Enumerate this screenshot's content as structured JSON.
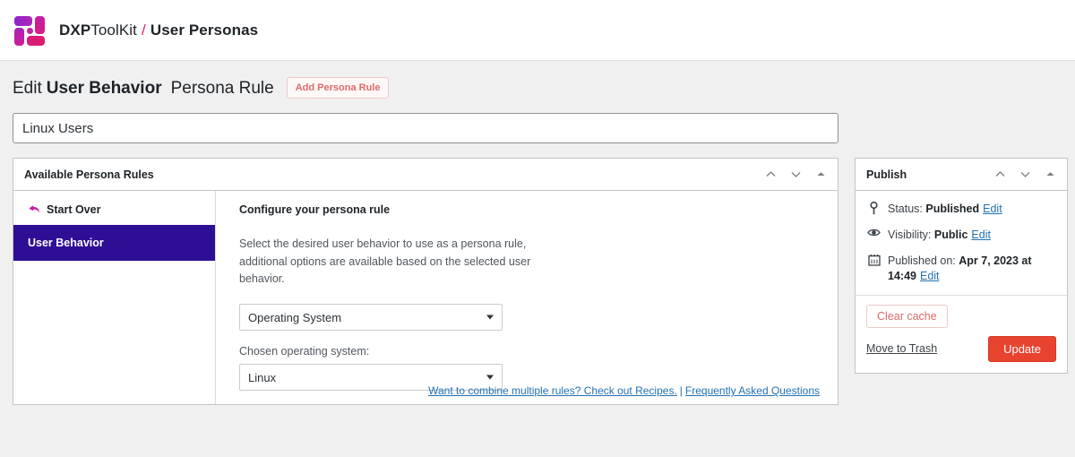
{
  "topbar": {
    "logo_icon": "dxp-logo-icon",
    "brand_strong": "DXP",
    "brand_light": "ToolKit",
    "separator": "/",
    "page_name": "User Personas"
  },
  "page": {
    "title_prefix": "Edit",
    "title_strong": "User Behavior",
    "title_suffix": "Persona Rule",
    "add_rule_label": "Add Persona Rule",
    "title_input_value": "Linux Users",
    "title_input_placeholder": "Add title"
  },
  "rules_box": {
    "heading": "Available Persona Rules",
    "tool_up_icon": "chevron-up-icon",
    "tool_down_icon": "chevron-down-icon",
    "tool_toggle_icon": "caret-up-toggle-icon",
    "nav": {
      "start_over_label": "Start Over",
      "start_over_icon": "back-arrow-icon",
      "items": [
        {
          "label": "User Behavior",
          "selected": true
        }
      ]
    },
    "content": {
      "config_title": "Configure your persona rule",
      "config_desc": "Select the desired user behavior to use as a persona rule, additional options are available based on the selected user behavior.",
      "behavior_select_value": "Operating System",
      "os_field_label": "Chosen operating system:",
      "os_select_value": "Linux",
      "recipes_link": "Want to combine multiple rules? Check out Recipes.",
      "link_separator": "|",
      "faq_link": "Frequently Asked Questions"
    }
  },
  "publish_box": {
    "heading": "Publish",
    "tool_up_icon": "chevron-up-icon",
    "tool_down_icon": "chevron-down-icon",
    "tool_toggle_icon": "caret-up-toggle-icon",
    "status": {
      "icon": "pin-icon",
      "label": "Status:",
      "value": "Published",
      "edit_label": "Edit"
    },
    "visibility": {
      "icon": "eye-icon",
      "label": "Visibility:",
      "value": "Public",
      "edit_label": "Edit"
    },
    "published_on": {
      "icon": "calendar-icon",
      "label": "Published on:",
      "value": "Apr 7, 2023 at 14:49",
      "edit_label": "Edit"
    },
    "clear_cache_label": "Clear cache",
    "trash_label": "Move to Trash",
    "update_label": "Update"
  },
  "colors": {
    "accent_indigo": "#2f0e96",
    "accent_magenta": "#c41fa2",
    "accent_red": "#e8432f",
    "link_blue": "#2271b1",
    "page_bg": "#f0f0f1"
  }
}
